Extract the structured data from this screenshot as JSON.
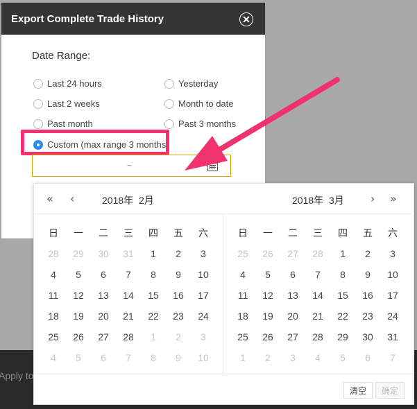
{
  "underlying": {
    "partial_text": "Apply to"
  },
  "modal": {
    "title": "Export Complete Trade History",
    "close_icon": "close-icon",
    "date_range_label": "Date Range:",
    "options": [
      {
        "label": "Last 24 hours",
        "checked": false
      },
      {
        "label": "Yesterday",
        "checked": false
      },
      {
        "label": "Last 2 weeks",
        "checked": false
      },
      {
        "label": "Month to date",
        "checked": false
      },
      {
        "label": "Past month",
        "checked": false
      },
      {
        "label": "Past 3 months",
        "checked": false
      },
      {
        "label": "Custom (max range 3 months)",
        "checked": true
      }
    ],
    "date_input": {
      "separator": "~",
      "icon": "calendar-icon"
    },
    "highlight_color": "#f0326f"
  },
  "calendar": {
    "left": {
      "year": "2018年",
      "month": "2月",
      "weekdays": [
        "日",
        "一",
        "二",
        "三",
        "四",
        "五",
        "六"
      ],
      "weeks": [
        [
          "28",
          "29",
          "30",
          "31",
          "1",
          "2",
          "3"
        ],
        [
          "4",
          "5",
          "6",
          "7",
          "8",
          "9",
          "10"
        ],
        [
          "11",
          "12",
          "13",
          "14",
          "15",
          "16",
          "17"
        ],
        [
          "18",
          "19",
          "20",
          "21",
          "22",
          "23",
          "24"
        ],
        [
          "25",
          "26",
          "27",
          "28",
          "1",
          "2",
          "3"
        ],
        [
          "4",
          "5",
          "6",
          "7",
          "8",
          "9",
          "10"
        ]
      ]
    },
    "right": {
      "year": "2018年",
      "month": "3月",
      "weekdays": [
        "日",
        "一",
        "二",
        "三",
        "四",
        "五",
        "六"
      ],
      "weeks": [
        [
          "25",
          "26",
          "27",
          "28",
          "1",
          "2",
          "3"
        ],
        [
          "4",
          "5",
          "6",
          "7",
          "8",
          "9",
          "10"
        ],
        [
          "11",
          "12",
          "13",
          "14",
          "15",
          "16",
          "17"
        ],
        [
          "18",
          "19",
          "20",
          "21",
          "22",
          "23",
          "24"
        ],
        [
          "25",
          "26",
          "27",
          "28",
          "29",
          "30",
          "31"
        ],
        [
          "1",
          "2",
          "3",
          "4",
          "5",
          "6",
          "7"
        ]
      ]
    },
    "nav": {
      "prev_year": "«",
      "prev_month": "‹",
      "next_month": "›",
      "next_year": "»"
    },
    "footer": {
      "clear_label": "清空",
      "confirm_label": "确定"
    }
  }
}
